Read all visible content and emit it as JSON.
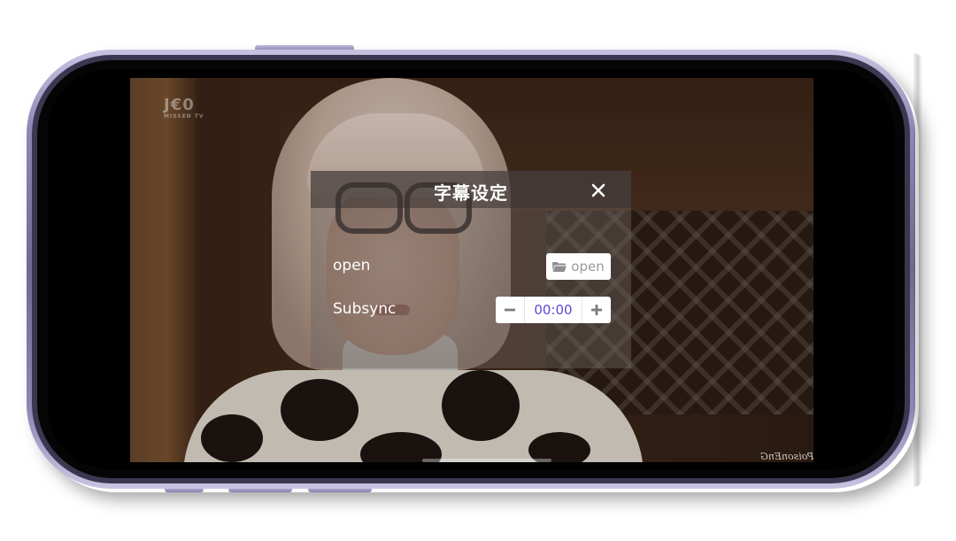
{
  "dialog": {
    "title": "字幕设定",
    "close_icon": "close-icon",
    "rows": {
      "open": {
        "label": "open",
        "button_label": "open",
        "button_icon": "folder-icon"
      },
      "subsync": {
        "label": "Subsync",
        "value": "00:00",
        "decrement_icon": "minus-icon",
        "increment_icon": "plus-icon"
      }
    }
  },
  "video": {
    "channel_logo": "J€0",
    "channel_logo_sub": "MISSEN TV",
    "watermark": "PoisonEnG"
  },
  "colors": {
    "stepper_value": "#5a4bd1",
    "dialog_text": "#ffffff",
    "phone_frame": "#8f87b4"
  }
}
